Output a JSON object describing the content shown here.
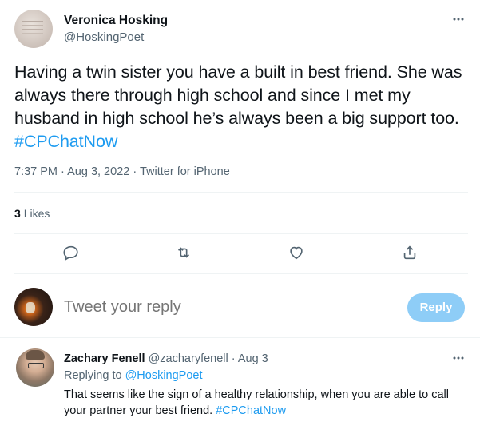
{
  "tweet": {
    "author_name": "Veronica Hosking",
    "author_handle": "@HoskingPoet",
    "text": "Having a twin sister you have a built in best friend. She was always there through high school and since I met my husband in high school he’s always been a big support too.",
    "hashtag": "#CPChatNow",
    "time": "7:37 PM",
    "separator": "·",
    "date": "Aug 3, 2022",
    "source": "Twitter for iPhone",
    "likes_count": "3",
    "likes_label": "Likes",
    "icons": {
      "more": "more-dots-icon",
      "reply": "reply-bubble-icon",
      "retweet": "retweet-icon",
      "like": "heart-icon",
      "share": "share-icon"
    }
  },
  "composer": {
    "placeholder": "Tweet your reply",
    "button_label": "Reply"
  },
  "reply": {
    "author_name": "Zachary Fenell",
    "author_handle": "@zacharyfenell",
    "separator": "·",
    "date": "Aug 3",
    "replying_prefix": "Replying to",
    "replying_to": "@HoskingPoet",
    "text": "That seems like the sign of a healthy relationship, when you are able to call your partner your best friend.",
    "hashtag": "#CPChatNow"
  },
  "colors": {
    "link": "#1d9bf0",
    "secondary_text": "#536471",
    "primary_text": "#0f1419",
    "reply_button_disabled": "#8ecdf7",
    "divider": "#eff3f4"
  }
}
